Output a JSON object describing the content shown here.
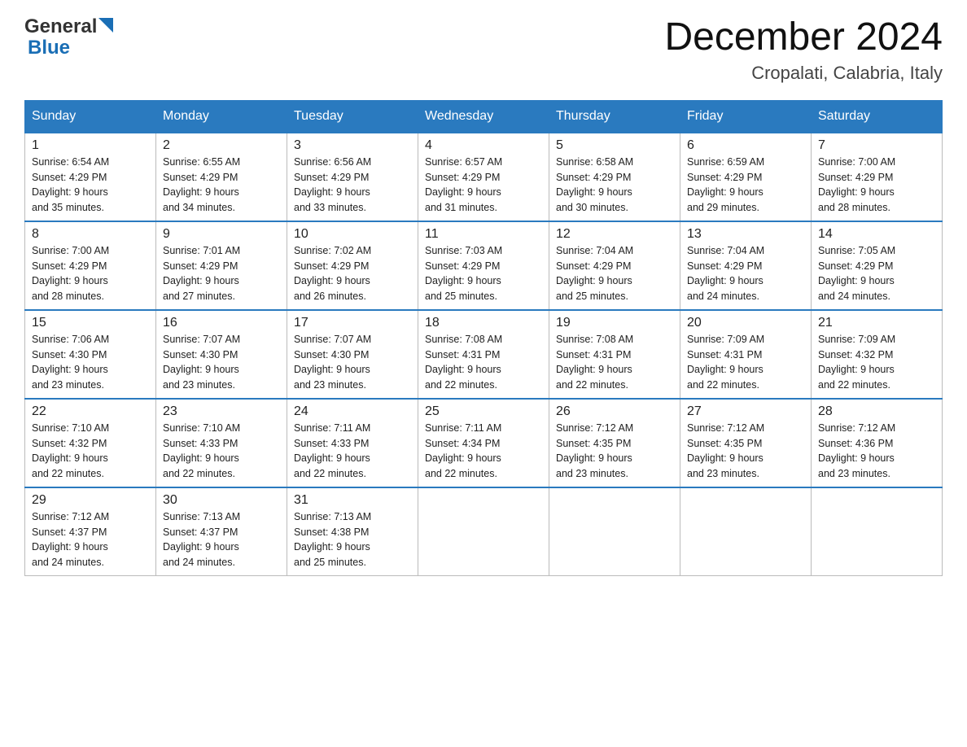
{
  "header": {
    "logo_general": "General",
    "logo_blue": "Blue",
    "month_title": "December 2024",
    "subtitle": "Cropalati, Calabria, Italy"
  },
  "weekdays": [
    "Sunday",
    "Monday",
    "Tuesday",
    "Wednesday",
    "Thursday",
    "Friday",
    "Saturday"
  ],
  "weeks": [
    [
      {
        "day": "1",
        "sunrise": "6:54 AM",
        "sunset": "4:29 PM",
        "daylight": "9 hours and 35 minutes."
      },
      {
        "day": "2",
        "sunrise": "6:55 AM",
        "sunset": "4:29 PM",
        "daylight": "9 hours and 34 minutes."
      },
      {
        "day": "3",
        "sunrise": "6:56 AM",
        "sunset": "4:29 PM",
        "daylight": "9 hours and 33 minutes."
      },
      {
        "day": "4",
        "sunrise": "6:57 AM",
        "sunset": "4:29 PM",
        "daylight": "9 hours and 31 minutes."
      },
      {
        "day": "5",
        "sunrise": "6:58 AM",
        "sunset": "4:29 PM",
        "daylight": "9 hours and 30 minutes."
      },
      {
        "day": "6",
        "sunrise": "6:59 AM",
        "sunset": "4:29 PM",
        "daylight": "9 hours and 29 minutes."
      },
      {
        "day": "7",
        "sunrise": "7:00 AM",
        "sunset": "4:29 PM",
        "daylight": "9 hours and 28 minutes."
      }
    ],
    [
      {
        "day": "8",
        "sunrise": "7:00 AM",
        "sunset": "4:29 PM",
        "daylight": "9 hours and 28 minutes."
      },
      {
        "day": "9",
        "sunrise": "7:01 AM",
        "sunset": "4:29 PM",
        "daylight": "9 hours and 27 minutes."
      },
      {
        "day": "10",
        "sunrise": "7:02 AM",
        "sunset": "4:29 PM",
        "daylight": "9 hours and 26 minutes."
      },
      {
        "day": "11",
        "sunrise": "7:03 AM",
        "sunset": "4:29 PM",
        "daylight": "9 hours and 25 minutes."
      },
      {
        "day": "12",
        "sunrise": "7:04 AM",
        "sunset": "4:29 PM",
        "daylight": "9 hours and 25 minutes."
      },
      {
        "day": "13",
        "sunrise": "7:04 AM",
        "sunset": "4:29 PM",
        "daylight": "9 hours and 24 minutes."
      },
      {
        "day": "14",
        "sunrise": "7:05 AM",
        "sunset": "4:29 PM",
        "daylight": "9 hours and 24 minutes."
      }
    ],
    [
      {
        "day": "15",
        "sunrise": "7:06 AM",
        "sunset": "4:30 PM",
        "daylight": "9 hours and 23 minutes."
      },
      {
        "day": "16",
        "sunrise": "7:07 AM",
        "sunset": "4:30 PM",
        "daylight": "9 hours and 23 minutes."
      },
      {
        "day": "17",
        "sunrise": "7:07 AM",
        "sunset": "4:30 PM",
        "daylight": "9 hours and 23 minutes."
      },
      {
        "day": "18",
        "sunrise": "7:08 AM",
        "sunset": "4:31 PM",
        "daylight": "9 hours and 22 minutes."
      },
      {
        "day": "19",
        "sunrise": "7:08 AM",
        "sunset": "4:31 PM",
        "daylight": "9 hours and 22 minutes."
      },
      {
        "day": "20",
        "sunrise": "7:09 AM",
        "sunset": "4:31 PM",
        "daylight": "9 hours and 22 minutes."
      },
      {
        "day": "21",
        "sunrise": "7:09 AM",
        "sunset": "4:32 PM",
        "daylight": "9 hours and 22 minutes."
      }
    ],
    [
      {
        "day": "22",
        "sunrise": "7:10 AM",
        "sunset": "4:32 PM",
        "daylight": "9 hours and 22 minutes."
      },
      {
        "day": "23",
        "sunrise": "7:10 AM",
        "sunset": "4:33 PM",
        "daylight": "9 hours and 22 minutes."
      },
      {
        "day": "24",
        "sunrise": "7:11 AM",
        "sunset": "4:33 PM",
        "daylight": "9 hours and 22 minutes."
      },
      {
        "day": "25",
        "sunrise": "7:11 AM",
        "sunset": "4:34 PM",
        "daylight": "9 hours and 22 minutes."
      },
      {
        "day": "26",
        "sunrise": "7:12 AM",
        "sunset": "4:35 PM",
        "daylight": "9 hours and 23 minutes."
      },
      {
        "day": "27",
        "sunrise": "7:12 AM",
        "sunset": "4:35 PM",
        "daylight": "9 hours and 23 minutes."
      },
      {
        "day": "28",
        "sunrise": "7:12 AM",
        "sunset": "4:36 PM",
        "daylight": "9 hours and 23 minutes."
      }
    ],
    [
      {
        "day": "29",
        "sunrise": "7:12 AM",
        "sunset": "4:37 PM",
        "daylight": "9 hours and 24 minutes."
      },
      {
        "day": "30",
        "sunrise": "7:13 AM",
        "sunset": "4:37 PM",
        "daylight": "9 hours and 24 minutes."
      },
      {
        "day": "31",
        "sunrise": "7:13 AM",
        "sunset": "4:38 PM",
        "daylight": "9 hours and 25 minutes."
      },
      null,
      null,
      null,
      null
    ]
  ],
  "labels": {
    "sunrise": "Sunrise:",
    "sunset": "Sunset:",
    "daylight": "Daylight:"
  }
}
